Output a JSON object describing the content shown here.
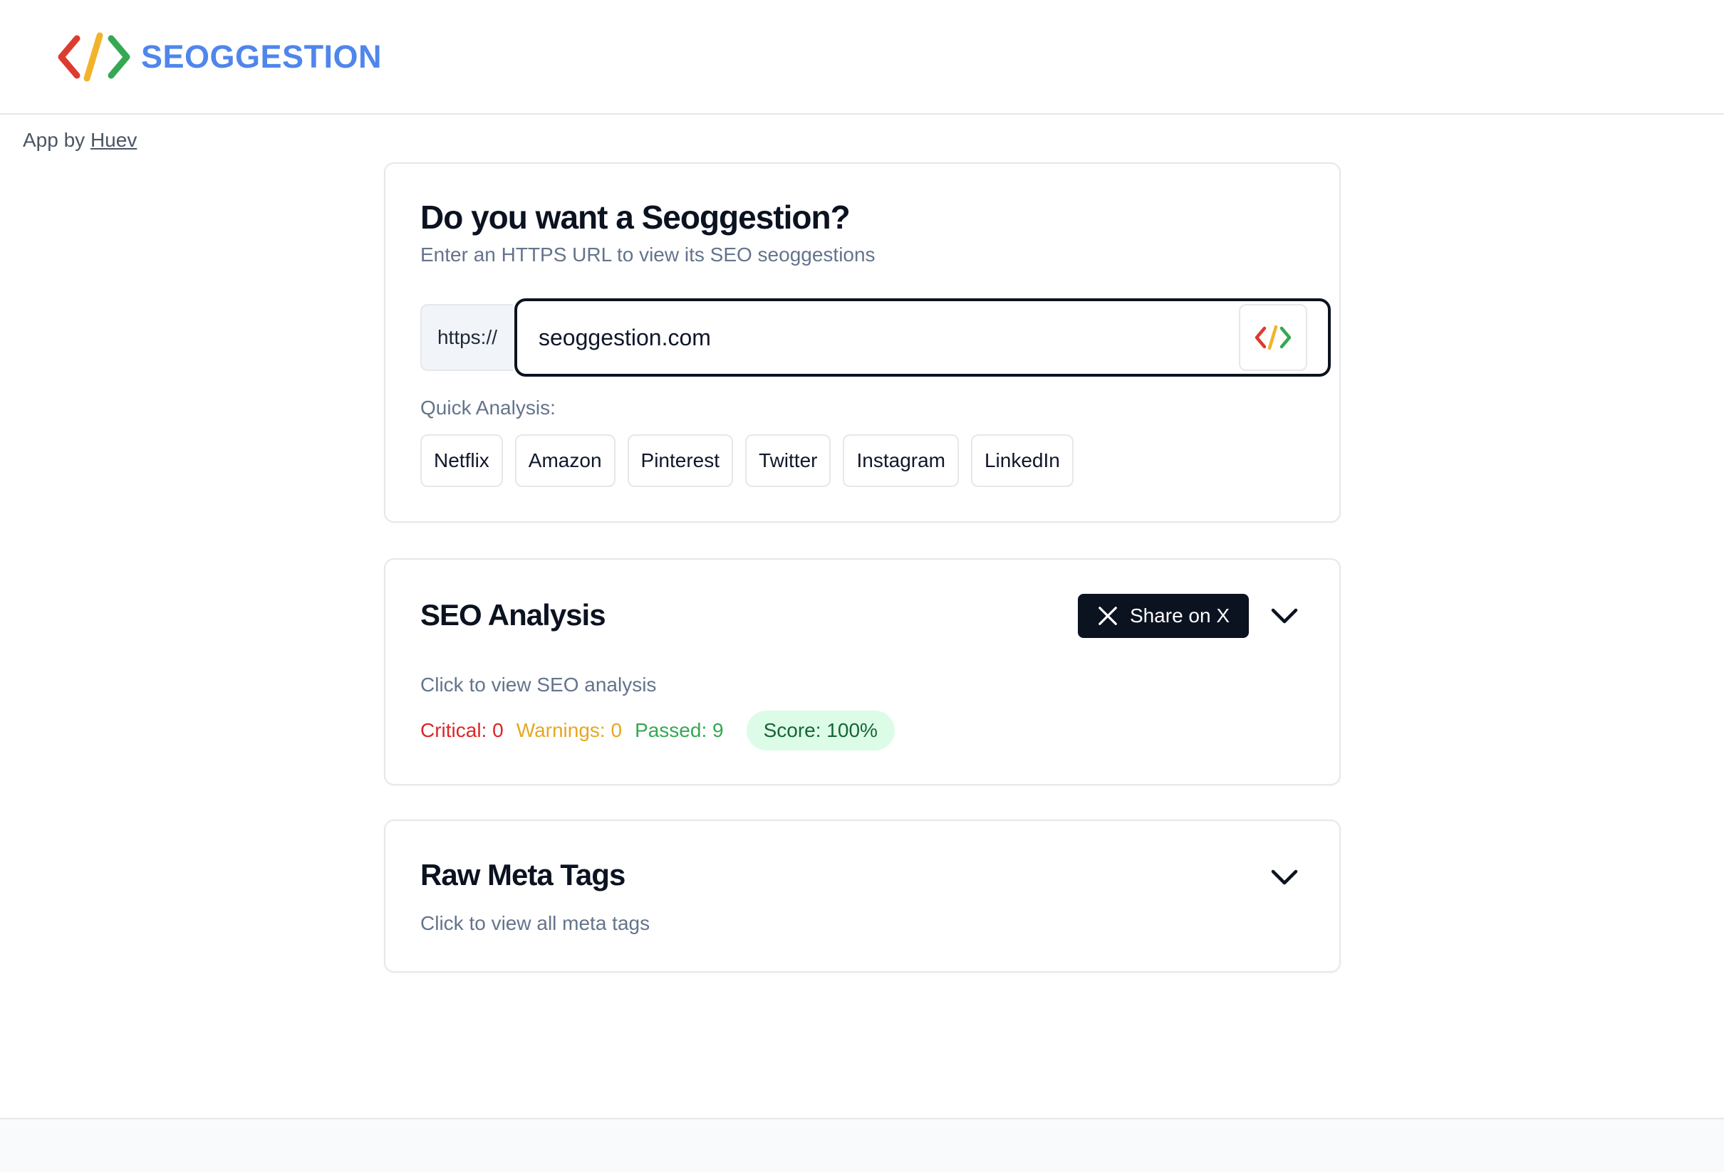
{
  "brand": {
    "name": "SEOGGESTION",
    "colors": {
      "red": "#dc3b2f",
      "yellow": "#f2b32b",
      "green": "#34a853",
      "blue": "#4f86ec"
    },
    "logo_icon": "code-brackets-icon"
  },
  "credit": {
    "prefix": "App by",
    "author": "Huev"
  },
  "search_card": {
    "title": "Do you want a Seoggestion?",
    "subtitle": "Enter an HTTPS URL to view its SEO seoggestions",
    "prefix": "https://",
    "url_value": "seoggestion.com",
    "submit_icon": "code-brackets-icon",
    "quick_label": "Quick Analysis:",
    "quick_sites": [
      "Netflix",
      "Amazon",
      "Pinterest",
      "Twitter",
      "Instagram",
      "LinkedIn"
    ]
  },
  "seo_card": {
    "title": "SEO Analysis",
    "share_label": "Share on X",
    "share_icon": "x-logo-icon",
    "subtitle": "Click to view SEO analysis",
    "critical": "Critical: 0",
    "warnings": "Warnings: 0",
    "passed": "Passed: 9",
    "score": "Score: 100%",
    "expand_icon": "chevron-down-icon"
  },
  "meta_card": {
    "title": "Raw Meta Tags",
    "subtitle": "Click to view all meta tags",
    "expand_icon": "chevron-down-icon"
  }
}
